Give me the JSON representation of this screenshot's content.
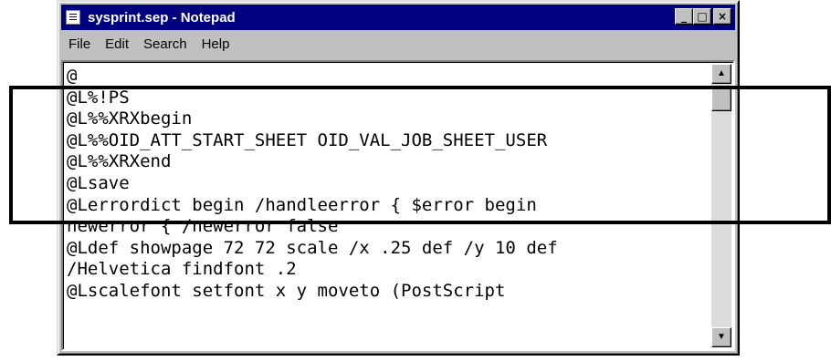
{
  "window": {
    "title": "sysprint.sep - Notepad",
    "buttons": {
      "minimize": "_",
      "maximize": "□",
      "close": "×"
    }
  },
  "menubar": {
    "items": [
      "File",
      "Edit",
      "Search",
      "Help"
    ]
  },
  "editor": {
    "lines": [
      "@",
      "@L%!PS",
      "@L%%XRXbegin",
      "@L%%OID_ATT_START_SHEET OID_VAL_JOB_SHEET_USER",
      "@L%%XRXend",
      "@Lsave",
      "@Lerrordict begin /handleerror { $error begin",
      "newerror { /newerror false",
      "@Ldef showpage 72 72 scale /x .25 def /y 10 def",
      "/Helvetica findfont .2",
      "@Lscalefont setfont x y moveto (PostScript"
    ]
  },
  "scrollbar": {
    "up_arrow": "▲",
    "down_arrow": "▼"
  }
}
